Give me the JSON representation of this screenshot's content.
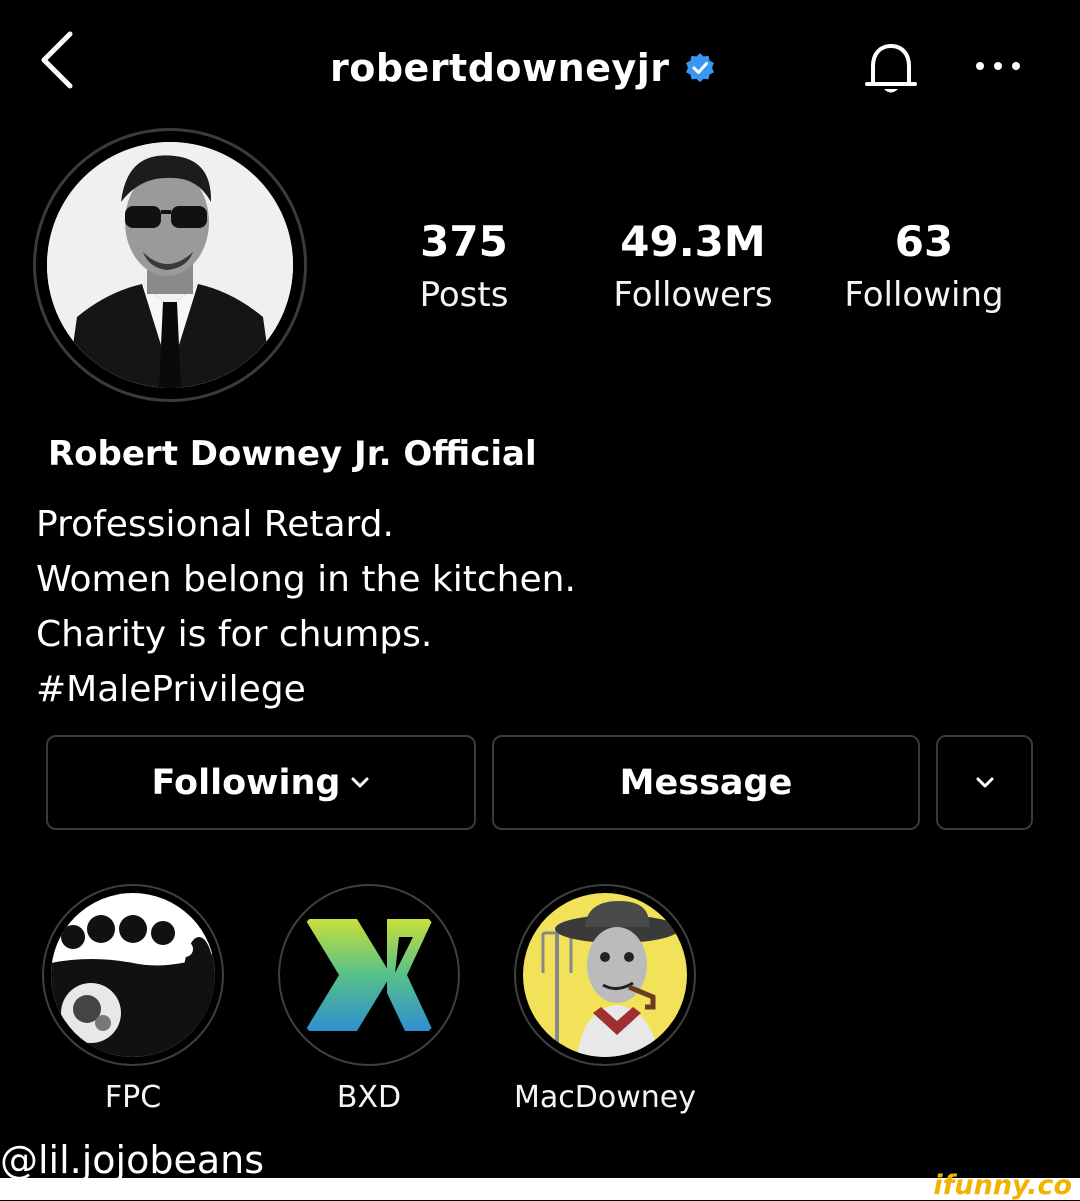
{
  "header": {
    "username": "robertdowneyjr",
    "icons": {
      "back": "chevron-left-icon",
      "verified": "verified-badge-icon",
      "bell": "bell-icon",
      "more": "ellipsis-icon"
    }
  },
  "stats": [
    {
      "value": "375",
      "label": "Posts"
    },
    {
      "value": "49.3M",
      "label": "Followers"
    },
    {
      "value": "63",
      "label": "Following"
    }
  ],
  "profile": {
    "display_name": "Robert Downey Jr. Official",
    "bio": [
      "Professional Retard.",
      "Women belong in the kitchen.",
      "Charity is for chumps.",
      "#MalePrivilege"
    ]
  },
  "actions": {
    "following_label": "Following",
    "message_label": "Message"
  },
  "highlights": [
    {
      "label": "FPC"
    },
    {
      "label": "BXD"
    },
    {
      "label": "MacDowney"
    }
  ],
  "footer": {
    "handle": "@lil.jojobeans",
    "watermark": "ifunny.co"
  },
  "colors": {
    "verified": "#3897f0",
    "border": "#3a3a3a",
    "watermark": "#f0b400"
  }
}
